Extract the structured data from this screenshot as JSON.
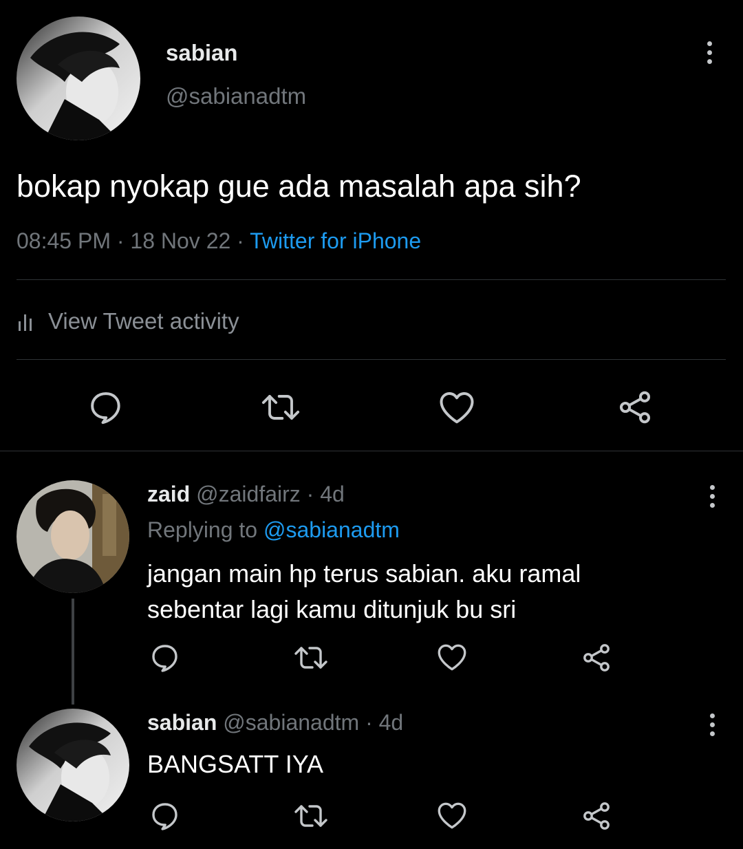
{
  "main_tweet": {
    "name": "sabian",
    "handle": "@sabianadtm",
    "text": "bokap nyokap gue ada masalah apa sih?",
    "time": "08:45 PM",
    "sep1": "·",
    "date": "18 Nov 22",
    "sep2": "·",
    "source": "Twitter for iPhone",
    "activity_label": "View Tweet activity"
  },
  "replies": [
    {
      "name": "zaid",
      "handle": "@zaidfairz",
      "sep": "·",
      "age": "4d",
      "replying_prefix": "Replying to",
      "replying_handle": "@sabianadtm",
      "text_line1": "jangan main hp terus sabian. aku ramal",
      "text_line2": "sebentar lagi kamu ditunjuk bu sri"
    },
    {
      "name": "sabian",
      "handle": "@sabianadtm",
      "sep": "·",
      "age": "4d",
      "text": "BANGSATT IYA"
    }
  ],
  "icons": {
    "reply": "reply-icon",
    "retweet": "retweet-icon",
    "like": "heart-icon",
    "share": "share-icon",
    "more": "more-vertical-icon",
    "activity": "bar-chart-icon"
  },
  "colors": {
    "background": "#000000",
    "text": "#e7e9ea",
    "muted": "#71767b",
    "link": "#1d9bf0",
    "divider": "#2f3336",
    "icon": "#c4c7ca"
  }
}
